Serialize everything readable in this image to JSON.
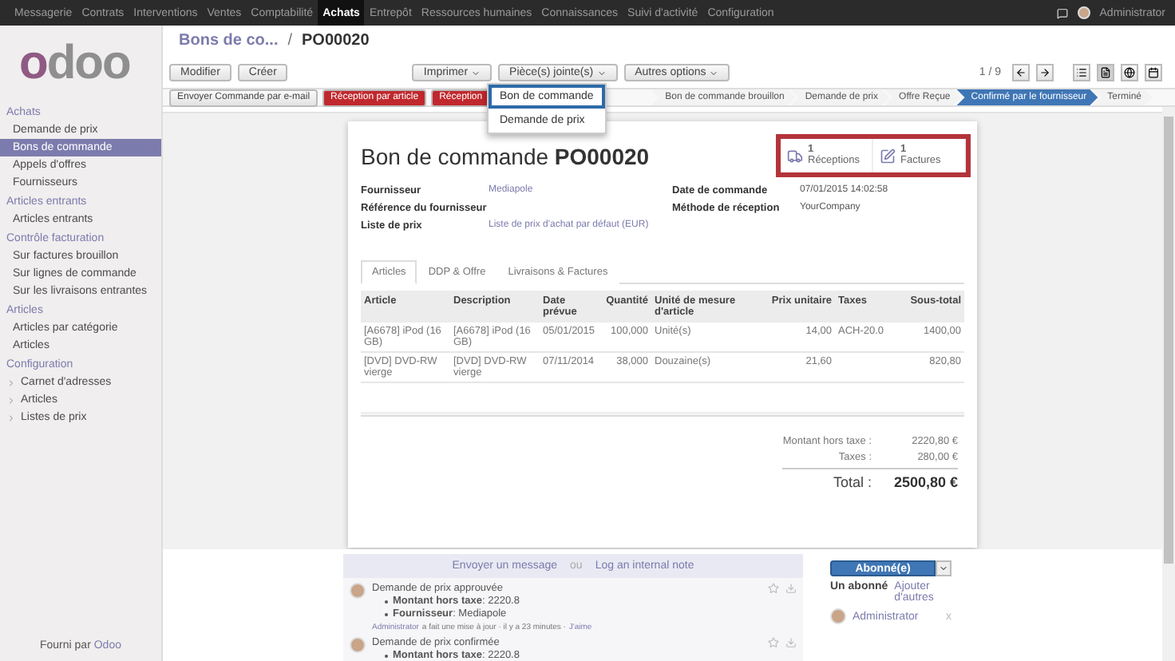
{
  "top_menu": {
    "items": [
      {
        "label": "Messagerie",
        "selected": false
      },
      {
        "label": "Contrats",
        "selected": false
      },
      {
        "label": "Interventions",
        "selected": false
      },
      {
        "label": "Ventes",
        "selected": false
      },
      {
        "label": "Comptabilité",
        "selected": false
      },
      {
        "label": "Achats",
        "selected": true
      },
      {
        "label": "Entrepôt",
        "selected": false
      },
      {
        "label": "Ressources humaines",
        "selected": false
      },
      {
        "label": "Connaissances",
        "selected": false
      },
      {
        "label": "Suivi d'activité",
        "selected": false
      },
      {
        "label": "Configuration",
        "selected": false
      }
    ],
    "user": "Administrator"
  },
  "logo": "odoo",
  "sidebar": {
    "sections": [
      {
        "title": "Achats",
        "items": [
          {
            "label": "Demande de prix",
            "selected": false
          },
          {
            "label": "Bons de commande",
            "selected": true
          },
          {
            "label": "Appels d'offres",
            "selected": false
          },
          {
            "label": "Fournisseurs",
            "selected": false
          }
        ]
      },
      {
        "title": "Articles entrants",
        "items": [
          {
            "label": "Articles entrants",
            "selected": false
          }
        ]
      },
      {
        "title": "Contrôle facturation",
        "items": [
          {
            "label": "Sur factures brouillon",
            "selected": false
          },
          {
            "label": "Sur lignes de commande",
            "selected": false
          },
          {
            "label": "Sur les livraisons entrantes",
            "selected": false
          }
        ]
      },
      {
        "title": "Articles",
        "items": [
          {
            "label": "Articles par catégorie",
            "selected": false
          },
          {
            "label": "Articles",
            "selected": false
          }
        ]
      },
      {
        "title": "Configuration",
        "items": [
          {
            "label": "Carnet d'adresses",
            "kind": "folder",
            "selected": false
          },
          {
            "label": "Articles",
            "kind": "folder",
            "selected": false
          },
          {
            "label": "Listes de prix",
            "kind": "folder",
            "selected": false
          }
        ]
      }
    ],
    "footer": {
      "text": "Fourni par",
      "link": "Odoo"
    }
  },
  "breadcrumb": {
    "parent": "Bons de co...",
    "separator": "/",
    "current": "PO00020"
  },
  "toolbar": {
    "buttons": [
      "Modifier",
      "Créer"
    ],
    "menus": [
      "Imprimer",
      "Pièce(s) jointe(s)",
      "Autres options"
    ],
    "pager": "1 / 9",
    "views": [
      {
        "kind": "list",
        "selected": false
      },
      {
        "kind": "form",
        "selected": true
      },
      {
        "kind": "map",
        "selected": false
      },
      {
        "kind": "calendar",
        "selected": false
      }
    ]
  },
  "print_menu": {
    "items": [
      {
        "label": "Bon de commande",
        "selected": true
      },
      {
        "label": "Demande de prix",
        "selected": false
      }
    ]
  },
  "actions": [
    {
      "label": "Envoyer Commande par e-mail",
      "kind": "default"
    },
    {
      "label": "Réception par article",
      "kind": "primary"
    },
    {
      "label": "Réception",
      "kind": "primary"
    }
  ],
  "stages": [
    {
      "label": "Bon de commande brouillon",
      "selected": false
    },
    {
      "label": "Demande de prix",
      "selected": false
    },
    {
      "label": "Offre Reçue",
      "selected": false
    },
    {
      "label": "Confirmé par le fournisseur",
      "selected": true
    },
    {
      "label": "Terminé",
      "selected": false
    }
  ],
  "sheet": {
    "title": "Bon de commande",
    "number": "PO00020",
    "smart_buttons": [
      {
        "kind": "truck",
        "count": "1",
        "label": "Réceptions"
      },
      {
        "kind": "invoice",
        "count": "1",
        "label": "Factures"
      }
    ],
    "fields_left": [
      {
        "label": "Fournisseur",
        "value": "Mediapole",
        "link": true
      },
      {
        "label": "Référence du fournisseur"
      },
      {
        "label": "Liste de prix",
        "value": "Liste de prix d'achat par défaut (EUR)",
        "link": true
      }
    ],
    "fields_right": [
      {
        "label": "Date de commande",
        "value": "07/01/2015 14:02:58",
        "link": false
      },
      {
        "label": "Méthode de réception",
        "value": "YourCompany",
        "link": false
      }
    ],
    "tabs": [
      {
        "label": "Articles",
        "selected": true
      },
      {
        "label": "DDP & Offre",
        "selected": false
      },
      {
        "label": "Livraisons & Factures",
        "selected": false
      }
    ],
    "table": {
      "columns": [
        "Article",
        "Description",
        "Date prévue",
        "Quantité",
        "Unité de mesure d'article",
        "Prix unitaire",
        "Taxes",
        "Sous-total"
      ],
      "rows": [
        [
          "[A6678] iPod (16 GB)",
          "[A6678] iPod (16 GB)",
          "05/01/2015",
          "100,000",
          "Unité(s)",
          "14,00",
          "ACH-20.0",
          "1400,00"
        ],
        [
          "[DVD] DVD-RW vierge",
          "[DVD] DVD-RW vierge",
          "07/11/2014",
          "38,000",
          "Douzaine(s)",
          "21,60",
          "",
          "820,80"
        ]
      ]
    },
    "totals": [
      {
        "label": "Montant hors taxe :",
        "value": "2220,80 €"
      },
      {
        "label": "Taxes :",
        "value": "280,00 €"
      }
    ],
    "total": {
      "label": "Total :",
      "value": "2500,80 €"
    }
  },
  "chatter": {
    "compose": {
      "send": "Envoyer un message",
      "or": "ou",
      "note": "Log an internal note"
    },
    "messages": [
      {
        "title": "Demande de prix approuvée",
        "changes": [
          "**Montant hors taxe**: 2220.8",
          "**Fournisseur**: Mediapole"
        ],
        "author": "Administrator",
        "meta": "a fait une mise à jour · il y a 23 minutes ·",
        "like": "J'aime"
      },
      {
        "title": "Demande de prix confirmée",
        "changes": [
          "**Montant hors taxe**: 2220.8"
        ]
      }
    ],
    "followers": {
      "button": "Abonné(e)",
      "count": "Un abonné",
      "add": "Ajouter d'autres",
      "list": [
        {
          "name": "Administrator",
          "remove": "x"
        }
      ]
    }
  }
}
